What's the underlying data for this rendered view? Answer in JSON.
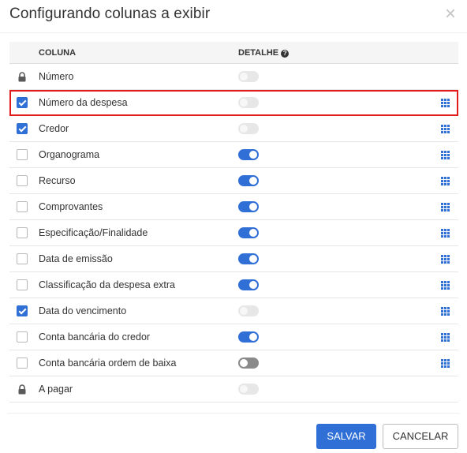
{
  "dialog": {
    "title": "Configurando colunas a exibir",
    "close_icon": "close-icon"
  },
  "table": {
    "headers": {
      "column": "COLUNA",
      "detail": "DETALHE"
    },
    "rows": [
      {
        "label": "Número",
        "lead": "lock",
        "detail": "disabled",
        "grid": false,
        "highlight": false
      },
      {
        "label": "Número da despesa",
        "lead": "checked",
        "detail": "disabled",
        "grid": true,
        "highlight": true
      },
      {
        "label": "Credor",
        "lead": "checked",
        "detail": "disabled",
        "grid": true,
        "highlight": false
      },
      {
        "label": "Organograma",
        "lead": "unchecked",
        "detail": "on",
        "grid": true,
        "highlight": false
      },
      {
        "label": "Recurso",
        "lead": "unchecked",
        "detail": "on",
        "grid": true,
        "highlight": false
      },
      {
        "label": "Comprovantes",
        "lead": "unchecked",
        "detail": "on",
        "grid": true,
        "highlight": false
      },
      {
        "label": "Especificação/Finalidade",
        "lead": "unchecked",
        "detail": "on",
        "grid": true,
        "highlight": false
      },
      {
        "label": "Data de emissão",
        "lead": "unchecked",
        "detail": "on",
        "grid": true,
        "highlight": false
      },
      {
        "label": "Classificação da despesa extra",
        "lead": "unchecked",
        "detail": "on",
        "grid": true,
        "highlight": false
      },
      {
        "label": "Data do vencimento",
        "lead": "checked",
        "detail": "disabled",
        "grid": true,
        "highlight": false
      },
      {
        "label": "Conta bancária do credor",
        "lead": "unchecked",
        "detail": "on",
        "grid": true,
        "highlight": false
      },
      {
        "label": "Conta bancária ordem de baixa",
        "lead": "unchecked",
        "detail": "off",
        "grid": true,
        "highlight": false
      },
      {
        "label": "A pagar",
        "lead": "lock",
        "detail": "disabled",
        "grid": false,
        "highlight": false
      }
    ]
  },
  "footer": {
    "save_label": "SALVAR",
    "cancel_label": "CANCELAR"
  },
  "colors": {
    "accent": "#2f6fd6",
    "highlight": "#e31b1b"
  }
}
